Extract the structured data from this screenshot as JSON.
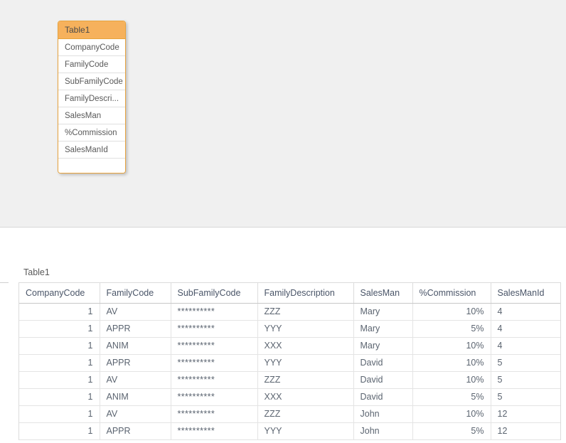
{
  "canvas": {
    "background_color": "#f0f0f0",
    "table_bubble": {
      "title": "Table1",
      "header_color": "#f6b15c",
      "border_color": "#e8a33d",
      "fields": [
        "CompanyCode",
        "FamilyCode",
        "SubFamilyCode",
        "FamilyDescri...",
        "SalesMan",
        "%Commission",
        "SalesManId"
      ]
    }
  },
  "preview": {
    "title": "Table1",
    "columns": [
      "CompanyCode",
      "FamilyCode",
      "SubFamilyCode",
      "FamilyDescription",
      "SalesMan",
      "%Commission",
      "SalesManId"
    ],
    "rows": [
      [
        "1",
        "AV",
        "**********",
        "ZZZ",
        "Mary",
        "10%",
        "4"
      ],
      [
        "1",
        "APPR",
        "**********",
        "YYY",
        "Mary",
        "5%",
        "4"
      ],
      [
        "1",
        "ANIM",
        "**********",
        "XXX",
        "Mary",
        "10%",
        "4"
      ],
      [
        "1",
        "APPR",
        "**********",
        "YYY",
        "David",
        "10%",
        "5"
      ],
      [
        "1",
        "AV",
        "**********",
        "ZZZ",
        "David",
        "10%",
        "5"
      ],
      [
        "1",
        "ANIM",
        "**********",
        "XXX",
        "David",
        "5%",
        "5"
      ],
      [
        "1",
        "AV",
        "**********",
        "ZZZ",
        "John",
        "10%",
        "12"
      ],
      [
        "1",
        "APPR",
        "**********",
        "YYY",
        "John",
        "5%",
        "12"
      ]
    ]
  }
}
